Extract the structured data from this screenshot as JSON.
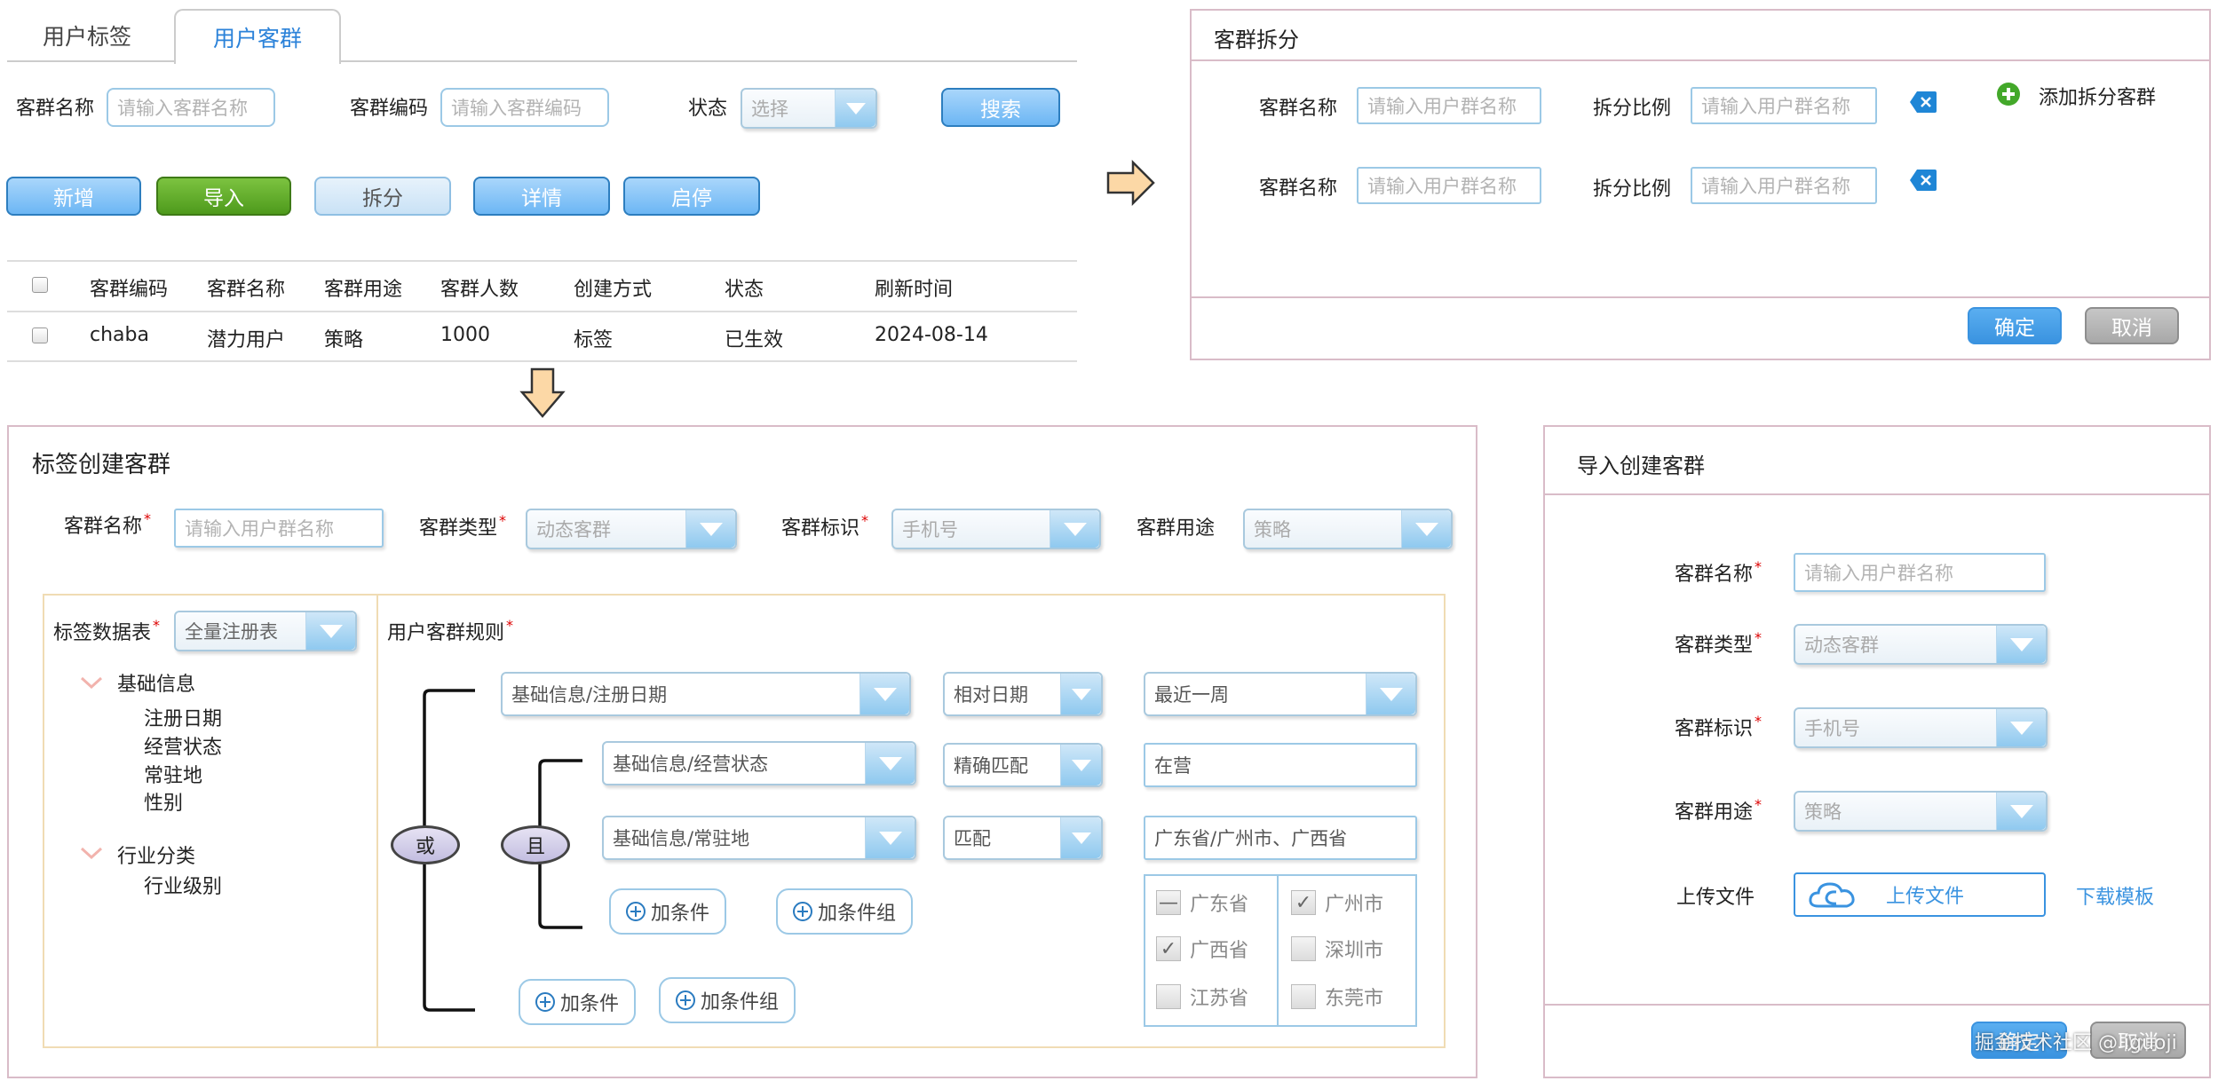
{
  "tabs": [
    "用户标签",
    "用户客群"
  ],
  "search": {
    "name_label": "客群名称",
    "name_ph": "请输入客群名称",
    "code_label": "客群编码",
    "code_ph": "请输入客群编码",
    "status_label": "状态",
    "status_ph": "选择",
    "search_btn": "搜索"
  },
  "toolbar": [
    "新增",
    "导入",
    "拆分",
    "详情",
    "启停"
  ],
  "table": {
    "headers": [
      "客群编码",
      "客群名称",
      "客群用途",
      "客群人数",
      "创建方式",
      "状态",
      "刷新时间"
    ],
    "rows": [
      [
        "chaba",
        "潜力用户",
        "策略",
        "1000",
        "标签",
        "已生效",
        "2024-08-14"
      ]
    ]
  },
  "split": {
    "title": "客群拆分",
    "name_label": "客群名称",
    "ratio_label": "拆分比例",
    "ph": "请输入用户群名称",
    "add": "添加拆分客群",
    "ok": "确定",
    "cancel": "取消"
  },
  "tagcreate": {
    "title": "标签创建客群",
    "name_label": "客群名称",
    "name_ph": "请输入用户群名称",
    "type_label": "客群类型",
    "type_val": "动态客群",
    "id_label": "客群标识",
    "id_val": "手机号",
    "use_label": "客群用途",
    "use_val": "策略",
    "table_label": "标签数据表",
    "table_val": "全量注册表",
    "rule_label": "用户客群规则",
    "tree": [
      {
        "group": "基础信息",
        "items": [
          "注册日期",
          "经营状态",
          "常驻地",
          "性别"
        ]
      },
      {
        "group": "行业分类",
        "items": [
          "行业级别"
        ]
      }
    ],
    "or": "或",
    "and": "且",
    "rules": [
      {
        "field": "基础信息/注册日期",
        "op": "相对日期",
        "val": "最近一周"
      },
      {
        "field": "基础信息/经营状态",
        "op": "精确匹配",
        "val": "在营"
      },
      {
        "field": "基础信息/常驻地",
        "op": "匹配",
        "val": "广东省/广州市、广西省"
      }
    ],
    "add_cond": "加条件",
    "add_group": "加条件组",
    "provinces": [
      {
        "name": "广东省",
        "state": "partial"
      },
      {
        "name": "广西省",
        "state": "checked"
      },
      {
        "name": "江苏省",
        "state": "none"
      }
    ],
    "cities": [
      {
        "name": "广州市",
        "state": "checked"
      },
      {
        "name": "深圳市",
        "state": "none"
      },
      {
        "name": "东莞市",
        "state": "none"
      }
    ]
  },
  "importcreate": {
    "title": "导入创建客群",
    "name_label": "客群名称",
    "name_ph": "请输入用户群名称",
    "type_label": "客群类型",
    "type_val": "动态客群",
    "id_label": "客群标识",
    "id_val": "手机号",
    "use_label": "客群用途",
    "use_val": "策略",
    "upload_label": "上传文件",
    "upload_btn": "上传文件",
    "download": "下载模板",
    "ok": "确定",
    "cancel": "取消"
  },
  "watermark": "掘金技术社区 @ iguoji",
  "colors": {
    "accent": "#3a93e0",
    "green": "#5aa82a"
  }
}
